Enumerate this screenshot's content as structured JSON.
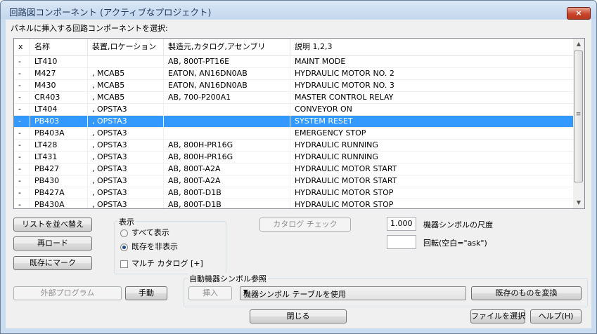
{
  "window": {
    "title": "回路図コンポーネント (アクティブなプロジェクト)",
    "close_icon": "×"
  },
  "prompt": "パネルに挿入する回路コンポーネントを選択:",
  "columns": [
    "x",
    "名称",
    "装置,ロケーション",
    "製造元,カタログ,アセンブリ",
    "説明 1,2,3"
  ],
  "rows": [
    [
      "-",
      "LT410",
      "",
      "AB, 800T-PT16E",
      "MAINT MODE"
    ],
    [
      "-",
      "M427",
      ", MCAB5",
      "EATON, AN16DN0AB",
      "HYDRAULIC MOTOR NO. 2"
    ],
    [
      "-",
      "M430",
      ", MCAB5",
      "EATON, AN16DN0AB",
      "HYDRAULIC MOTOR NO. 3"
    ],
    [
      "-",
      "CR403",
      ", MCAB5",
      "AB, 700-P200A1",
      "MASTER CONTROL RELAY"
    ],
    [
      "-",
      "LT404",
      ", OPSTA3",
      "",
      "CONVEYOR ON"
    ],
    [
      "-",
      "PB403",
      ", OPSTA3",
      "",
      "SYSTEM RESET"
    ],
    [
      "-",
      "PB403A",
      ", OPSTA3",
      "",
      "EMERGENCY STOP"
    ],
    [
      "-",
      "LT428",
      ", OPSTA3",
      "AB, 800H-PR16G",
      "HYDRAULIC RUNNING"
    ],
    [
      "-",
      "LT431",
      ", OPSTA3",
      "AB, 800H-PR16G",
      "HYDRAULIC RUNNING"
    ],
    [
      "-",
      "PB427",
      ", OPSTA3",
      "AB, 800T-A2A",
      "HYDRAULIC MOTOR START"
    ],
    [
      "-",
      "PB430",
      ", OPSTA3",
      "AB, 800T-A2A",
      "HYDRAULIC MOTOR START"
    ],
    [
      "-",
      "PB427A",
      ", OPSTA3",
      "AB, 800T-D1B",
      "HYDRAULIC MOTOR STOP"
    ],
    [
      "-",
      "PB430A",
      ", OPSTA3",
      "AB, 800T-D1B",
      "HYDRAULIC MOTOR STOP"
    ]
  ],
  "selected_row_index": 5,
  "buttons": {
    "sort": "リストを並べ替え",
    "reload": "再ロード",
    "mark_existing": "既存にマーク",
    "catalog_check": "カタログ チェック",
    "external_program": "外部プログラム",
    "manual": "手動",
    "insert": "挿入",
    "convert_existing": "既存のものを変換",
    "close": "閉じる",
    "select_file": "ファイルを選択",
    "help": "ヘルプ(H)"
  },
  "display_group": {
    "label": "表示",
    "show_all": "すべて表示",
    "hide_existing": "既存を非表示",
    "selected": "hide_existing",
    "multi_catalog": "マルチ カタログ [+]",
    "multi_catalog_checked": false
  },
  "symbol_scale": {
    "value": "1.000",
    "label": "機器シンボルの尺度"
  },
  "rotation": {
    "value": "",
    "label": "回転(空白=\"ask\")"
  },
  "auto_symbol_group": {
    "label": "自動機器シンボル参照",
    "combo_value": "機器シンボル テーブルを使用"
  },
  "colors": {
    "selection": "#3399ff",
    "titlebar": "#c9dcf0",
    "close": "#c9462c"
  }
}
